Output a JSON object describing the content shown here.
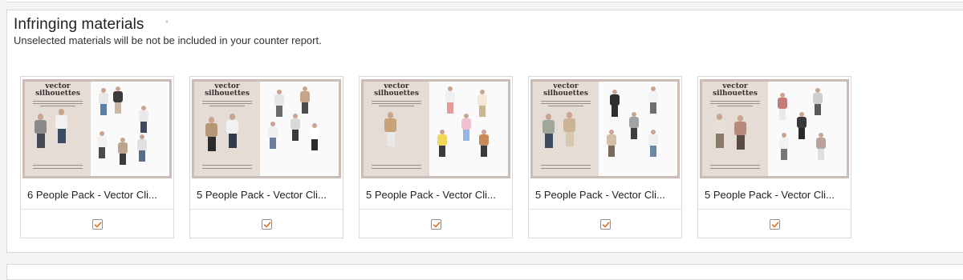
{
  "section": {
    "title": "Infringing materials",
    "required_mark": "*",
    "subtitle": "Unselected materials will be not be included in your counter report."
  },
  "thumbnail_text": "vector silhouettes",
  "materials": [
    {
      "title": "6 People Pack - Vector Cli...",
      "checked": true
    },
    {
      "title": "5 People Pack - Vector Cli...",
      "checked": true
    },
    {
      "title": "5 People Pack - Vector Cli...",
      "checked": true
    },
    {
      "title": "5 People Pack - Vector Cli...",
      "checked": true
    },
    {
      "title": "5 People Pack - Vector Cli...",
      "checked": true
    }
  ],
  "colors": {
    "checkmark": "#e0701f",
    "thumb_border": "#cbbdb6",
    "thumb_left_bg": "#e6dcd6"
  }
}
